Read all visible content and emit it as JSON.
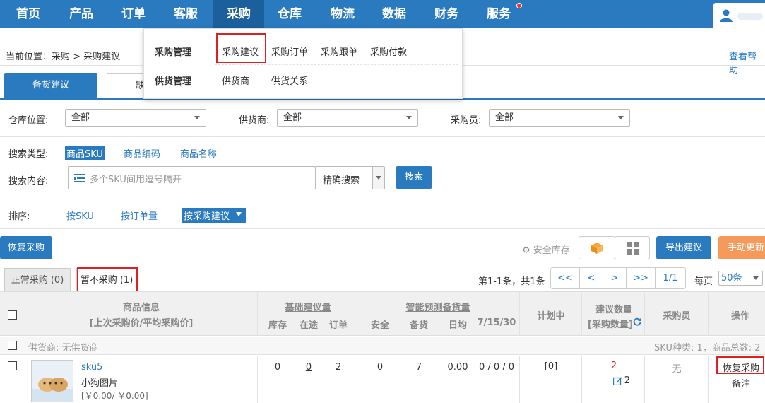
{
  "nav": {
    "items": [
      "首页",
      "产品",
      "订单",
      "客服",
      "采购",
      "仓库",
      "物流",
      "数据",
      "财务",
      "服务"
    ]
  },
  "dropdown": {
    "group1_title": "采购管理",
    "group1_links": [
      "采购建议",
      "采购订单",
      "采购跟单",
      "采购付款"
    ],
    "group2_title": "供货管理",
    "group2_links": [
      "供货商",
      "供货关系"
    ]
  },
  "breadcrumb": {
    "prefix": "当前位置：",
    "path": "采购 > 采购建议",
    "help": "查看帮助"
  },
  "tabs": {
    "active": "备货建议",
    "second": "缺"
  },
  "filters": {
    "warehouse_label": "仓库位置:",
    "warehouse_value": "全部",
    "supplier_label": "供货商:",
    "supplier_value": "全部",
    "buyer_label": "采购员:",
    "buyer_value": "全部"
  },
  "search": {
    "type_label": "搜索类型:",
    "types": [
      "商品SKU",
      "商品编码",
      "商品名称"
    ],
    "content_label": "搜索内容:",
    "placeholder": "多个SKU间用逗号隔开",
    "mode": "精确搜索",
    "button": "搜索"
  },
  "sort": {
    "label": "排序:",
    "options": [
      "按SKU",
      "按订单量",
      "按采购建议"
    ]
  },
  "toolbar": {
    "resume": "恢复采购",
    "safety_stock": "安全库存",
    "export": "导出建议",
    "manual_update": "手动更新"
  },
  "subtabs": {
    "normal": "正常采购 (0)",
    "paused": "暂不采购 (1)"
  },
  "pagination": {
    "summary": "第1-1条，共1条",
    "first": "<<",
    "prev": "<",
    "next": ">",
    "last": ">>",
    "page": "1/1",
    "per_page_label": "每页",
    "per_page_value": "50条"
  },
  "table": {
    "h_product": "商品信息",
    "h_product_sub": "[上次采购价/平均采购价]",
    "h_basic": "基础建议量",
    "h_basic_cols": [
      "库存",
      "在途",
      "订单"
    ],
    "h_smart": "智能预测备货量",
    "h_smart_cols": [
      "安全",
      "备货",
      "日均",
      "7/15/30"
    ],
    "h_planning": "计划中",
    "h_suggest": "建议数量",
    "h_suggest_sub": "[采购数量]",
    "h_buyer": "采购员",
    "h_action": "操作",
    "group_supplier": "供货商:  无供货商",
    "group_summary": "SKU种类: 1，商品总数: 2",
    "row": {
      "sku": "sku5",
      "name": "小狗图片",
      "price": "[￥0.00/ ￥0.00]",
      "stock": "0",
      "transit": "0",
      "order": "2",
      "safe": "0",
      "prepare": "7",
      "daily": "0.00",
      "trend": "0 / 0 / 0",
      "planning": "[0]",
      "suggest": "2",
      "purchase": "2",
      "buyer": "无",
      "action1": "恢复采购",
      "action2": "备注"
    }
  }
}
